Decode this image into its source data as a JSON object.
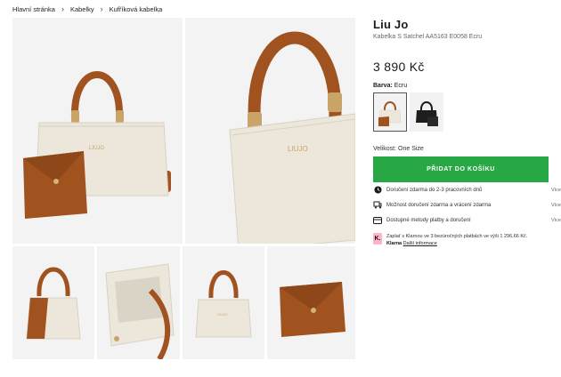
{
  "breadcrumb": {
    "items": [
      "Hlavní stránka",
      "Kabelky",
      "Kufříková kabelka"
    ]
  },
  "product": {
    "brand": "Liu Jo",
    "name": "Kabelka S Satchel AA5163 E0058 Ecru",
    "price": "3 890 Kč",
    "color_label": "Barva:",
    "color_value": "Ecru",
    "size_label": "Velikost:",
    "size_value": "One Size",
    "add_to_cart": "PŘIDAT DO KOŠÍKU",
    "bag_logo": "LIUJO"
  },
  "swatches": [
    {
      "name": "Ecru",
      "selected": true
    },
    {
      "name": "Black",
      "selected": false
    }
  ],
  "features": [
    {
      "icon": "clock-icon",
      "text": "Doručení zdarma do 2-3 pracovních dnů",
      "more": "Více"
    },
    {
      "icon": "return-icon",
      "text": "Možnost doručení zdarma a vrácení zdarma",
      "more": "Více"
    },
    {
      "icon": "card-icon",
      "text": "Dostupné metody platby a doručení",
      "more": "Více"
    }
  ],
  "klarna": {
    "logo_letter": "K.",
    "text": "Zaplať s Klarnou ve 3 bezúročných platbách ve výši 1 296,66 Kč.",
    "brand": "Klarna",
    "link": "Další informace"
  },
  "colors": {
    "accent_green": "#28a745",
    "bag_cream": "#ece7da",
    "leather_brown": "#a0521f",
    "hardware_gold": "#c9a468",
    "klarna_pink": "#ffb3c7"
  }
}
